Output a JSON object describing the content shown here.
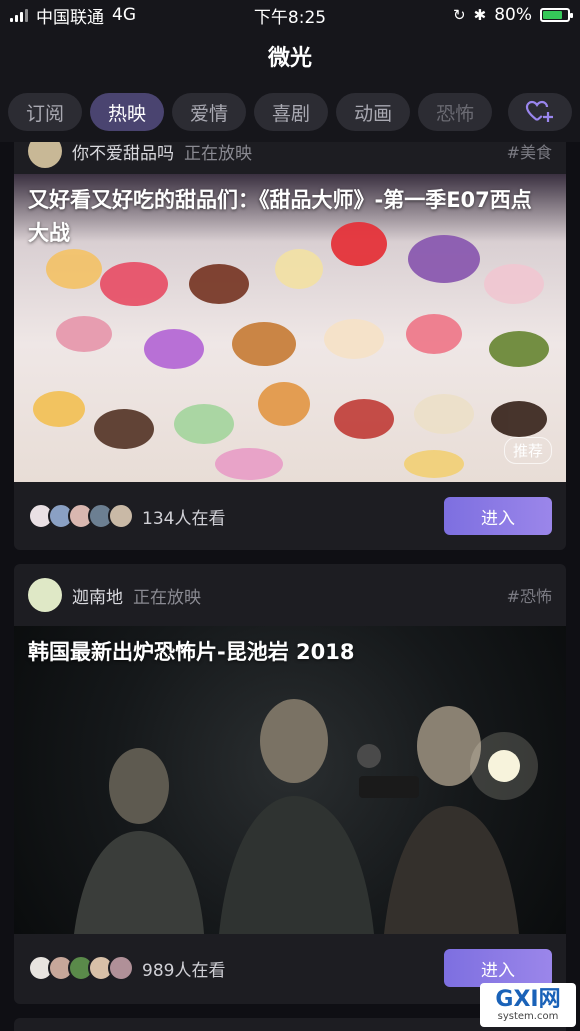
{
  "status_bar": {
    "carrier": "中国联通",
    "network": "4G",
    "time": "下午8:25",
    "battery": "80%",
    "battery_level": 0.8
  },
  "header": {
    "title": "微光"
  },
  "tabs": [
    {
      "label": "订阅"
    },
    {
      "label": "热映"
    },
    {
      "label": "爱情"
    },
    {
      "label": "喜剧"
    },
    {
      "label": "动画"
    },
    {
      "label": "恐怖"
    }
  ],
  "cards": [
    {
      "username": "你不爱甜品吗",
      "status": "正在放映",
      "tag": "#美食",
      "title": "又好看又好吃的甜品们：《甜品大师》-第一季E07西点大战",
      "badge": "推荐",
      "viewers": "134人在看",
      "enter_label": "进入"
    },
    {
      "username": "迦南地",
      "status": "正在放映",
      "tag": "#恐怖",
      "title": "韩国最新出炉恐怖片-昆池岩 2018",
      "viewers": "989人在看",
      "enter_label": "进入"
    }
  ],
  "watermark": {
    "brand": "GXI网",
    "site": "system.com"
  },
  "colors": {
    "accent": "#8a78e6",
    "active_tab": "#4a4470",
    "background": "#0f0f14"
  }
}
